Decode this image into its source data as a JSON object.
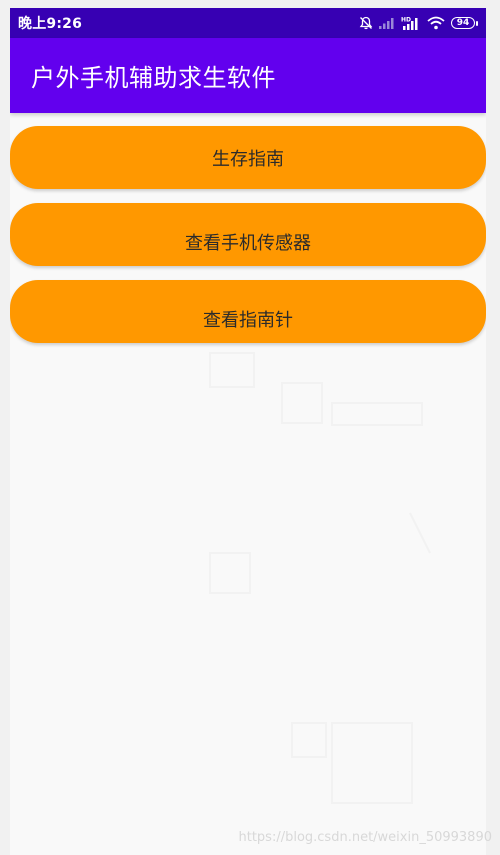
{
  "status_bar": {
    "time": "晚上9:26",
    "icons": [
      "bell-off-icon",
      "signal-weak-icon",
      "signal-hd-icon",
      "wifi-icon",
      "battery-icon"
    ],
    "signal_label": "HD",
    "battery_level": "94"
  },
  "app_bar": {
    "title": "户外手机辅助求生软件"
  },
  "buttons": [
    {
      "label": "生存指南"
    },
    {
      "label": "查看手机传感器"
    },
    {
      "label": "查看指南针"
    }
  ],
  "watermark": "https://blog.csdn.net/weixin_50993890",
  "colors": {
    "status_bar": "#3700b3",
    "app_bar": "#6200ee",
    "button": "#ff9800",
    "background": "#f9f9f9"
  }
}
